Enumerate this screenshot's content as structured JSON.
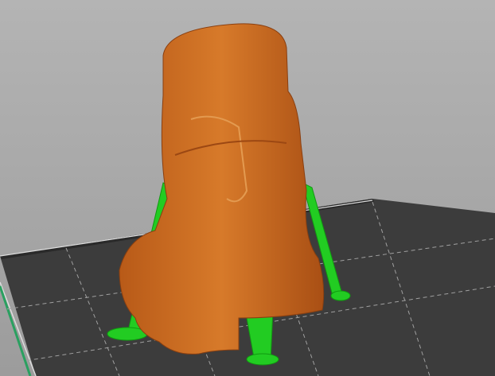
{
  "viewport": {
    "title": "3D preview"
  },
  "colors": {
    "background": "#a8a8a8",
    "bed": "#3a3a3a",
    "model": "#d2691e",
    "support": "#1ecf1e",
    "grid": "#9a9a9a"
  }
}
